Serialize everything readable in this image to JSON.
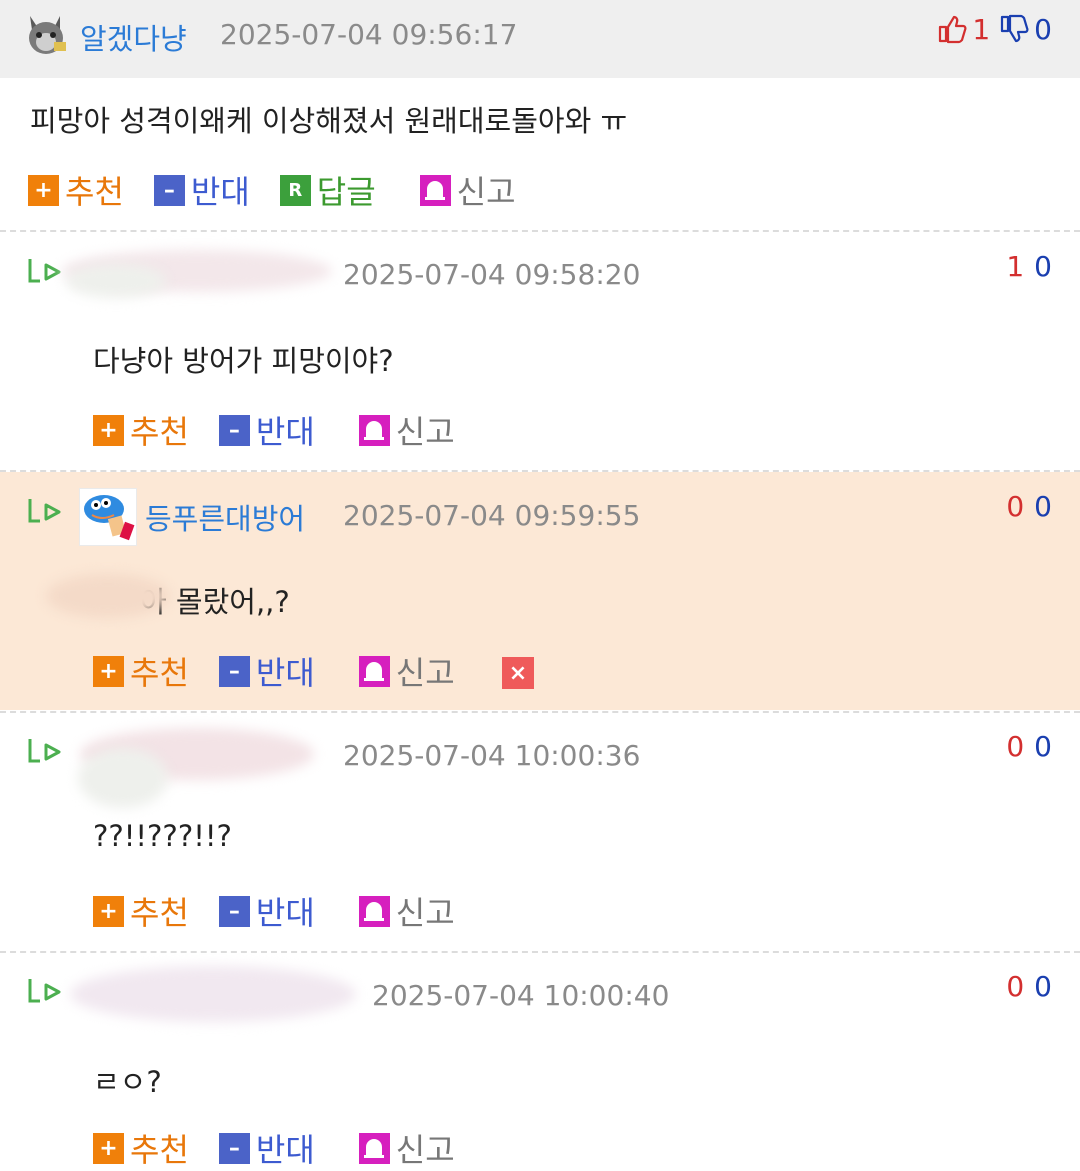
{
  "post": {
    "nickname": "알겠다냥",
    "date": "2025-07-04 09:56:17",
    "up_count": "1",
    "down_count": "0",
    "content": "피망아 성격이왜케 이상해졌서 원래대로돌아와 ㅠ",
    "actions": {
      "recommend": "추천",
      "oppose": "반대",
      "reply": "답글",
      "report": "신고"
    }
  },
  "comments": [
    {
      "nickname": "",
      "date": "2025-07-04 09:58:20",
      "votes": {
        "up": "1",
        "down": "0"
      },
      "content": "다냥아 방어가 피망이야?",
      "actions": {
        "recommend": "추천",
        "oppose": "반대",
        "report": "신고"
      }
    },
    {
      "nickname": "등푸른대방어",
      "date": "2025-07-04 09:59:55",
      "votes": {
        "up": "0",
        "down": "0"
      },
      "content": "아 몰랐어,,?",
      "actions": {
        "recommend": "추천",
        "oppose": "반대",
        "report": "신고",
        "delete": "×"
      }
    },
    {
      "nickname": "",
      "date": "2025-07-04 10:00:36",
      "votes": {
        "up": "0",
        "down": "0"
      },
      "content": "??!!???!!?",
      "actions": {
        "recommend": "추천",
        "oppose": "반대",
        "report": "신고"
      }
    },
    {
      "nickname": "",
      "date": "2025-07-04 10:00:40",
      "votes": {
        "up": "0",
        "down": "0"
      },
      "content": "ㄹㅇ?",
      "actions": {
        "recommend": "추천",
        "oppose": "반대",
        "report": "신고"
      }
    }
  ],
  "colors": {
    "header_bg": "#efefef",
    "highlight_bg": "#fce8d6",
    "nickname": "#2b7bd6",
    "recommend": "#e8770a",
    "oppose": "#3d5bd0",
    "reply": "#3c9a2f",
    "report_icon": "#d61fbe",
    "up_vote": "#d32f2f",
    "down_vote": "#1a3fb0"
  },
  "icons": {
    "thumbs_up": "thumbs-up-icon",
    "thumbs_down": "thumbs-down-icon",
    "reply_arrow": "reply-arrow-icon",
    "recommend": "plus-icon",
    "oppose": "minus-icon",
    "reply": "reply-r-icon",
    "report": "siren-icon",
    "delete": "close-icon"
  }
}
